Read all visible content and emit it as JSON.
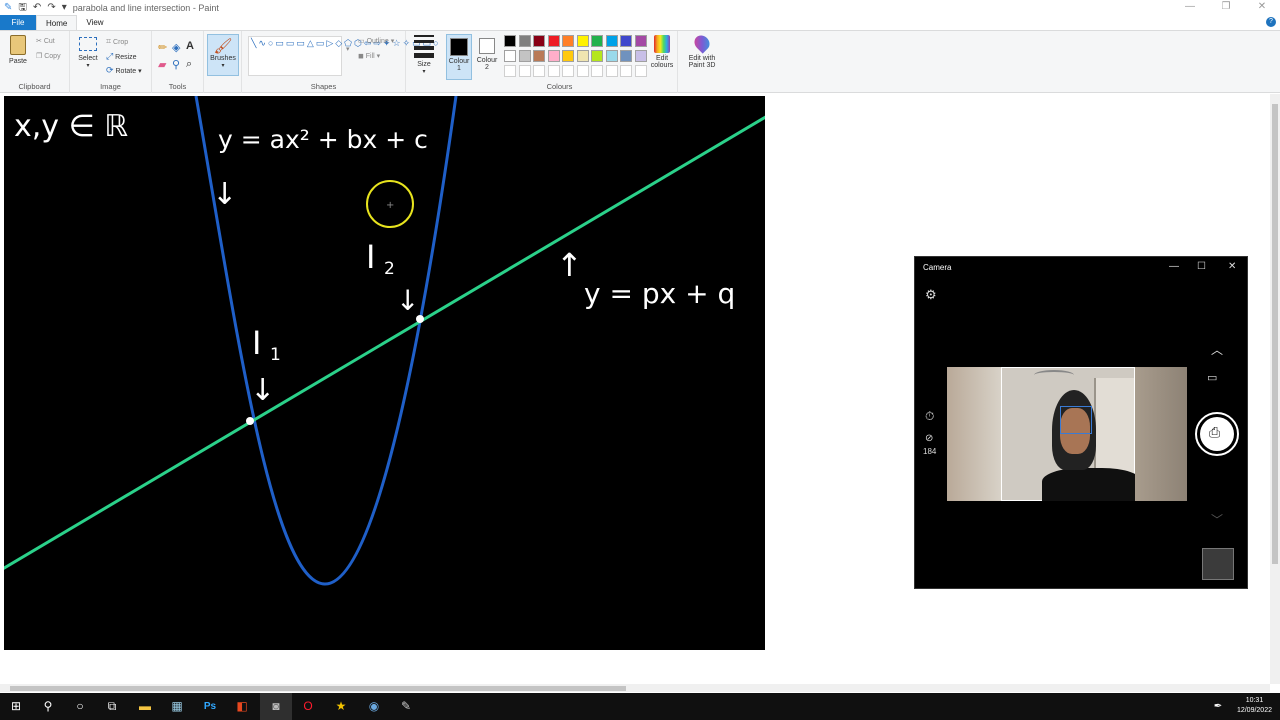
{
  "titlebar": {
    "title": "parabola and line intersection - Paint",
    "controls": [
      "—",
      "❐",
      "✕"
    ]
  },
  "tabs": [
    "File",
    "Home",
    "View"
  ],
  "ribbon": {
    "clipboard": {
      "label": "Clipboard",
      "paste": "Paste",
      "cut": "Cut",
      "copy": "Copy"
    },
    "image": {
      "label": "Image",
      "select": "Select",
      "crop": "Crop",
      "resize": "Resize",
      "rotate": "Rotate"
    },
    "tools": {
      "label": "Tools"
    },
    "brushes": {
      "label": "Brushes"
    },
    "shapes": {
      "label": "Shapes",
      "outline": "Outline",
      "fill": "Fill"
    },
    "size": {
      "label": "Size"
    },
    "colours": {
      "label": "Colours",
      "colour1": "Colour",
      "colour1_num": "1",
      "colour2": "Colour",
      "colour2_num": "2",
      "edit_colours_1": "Edit",
      "edit_colours_2": "colours",
      "edit_paint3d_1": "Edit with",
      "edit_paint3d_2": "Paint 3D",
      "palette_row1": [
        "#000000",
        "#7f7f7f",
        "#880015",
        "#ed1c24",
        "#ff7f27",
        "#fff200",
        "#22b14c",
        "#00a2e8",
        "#3f48cc",
        "#a349a4"
      ],
      "palette_row2": [
        "#ffffff",
        "#c3c3c3",
        "#b97a57",
        "#ffaec9",
        "#ffc90e",
        "#efe4b0",
        "#b5e61d",
        "#99d9ea",
        "#7092be",
        "#c8bfe7"
      ]
    }
  },
  "canvas": {
    "colors": {
      "parabola": "#1f5fc8",
      "line": "#2bd18a",
      "ink": "#ffffff",
      "cursor": "#e8e41e"
    },
    "annotations": {
      "domain": "x,y ∈ ℝ",
      "parabola_eq": "y = ax² + bx + c",
      "line_eq": "y = px + q",
      "i1": "I",
      "i1_sub": "1",
      "i2": "I",
      "i2_sub": "2",
      "arrow_down": "↓",
      "arrow_up": "↑"
    }
  },
  "camera": {
    "title": "Camera",
    "controls": [
      "—",
      "☐",
      "✕"
    ],
    "counter": "184"
  },
  "taskbar": {
    "time": "10:31",
    "date": "12/09/2022"
  }
}
